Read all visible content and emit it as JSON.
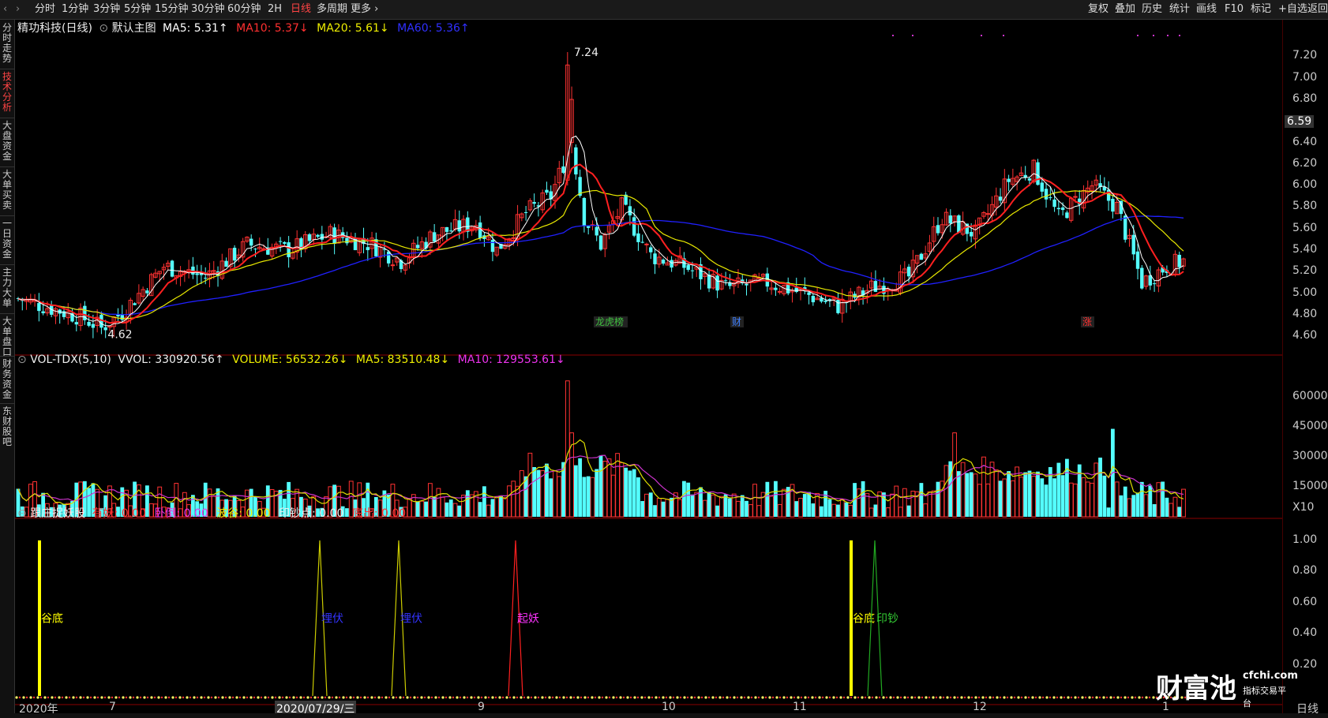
{
  "toolbar": {
    "periods": [
      {
        "label": "分时",
        "selected": false
      },
      {
        "label": "1分钟",
        "selected": false
      },
      {
        "label": "3分钟",
        "selected": false
      },
      {
        "label": "5分钟",
        "selected": false
      },
      {
        "label": "15分钟",
        "selected": false
      },
      {
        "label": "30分钟",
        "selected": false
      },
      {
        "label": "60分钟",
        "selected": false
      },
      {
        "label": "2H",
        "selected": false
      },
      {
        "label": "日线",
        "selected": true
      },
      {
        "label": "多周期",
        "selected": false
      }
    ],
    "more_label": "更多",
    "tools": [
      "复权",
      "叠加",
      "历史",
      "统计",
      "画线",
      "F10",
      "标记",
      "+自选",
      "返回"
    ]
  },
  "left_tabs": [
    {
      "label": "分时走势",
      "selected": false
    },
    {
      "label": "技术分析",
      "selected": true
    },
    {
      "label": "大盘资金",
      "selected": false
    },
    {
      "label": "大单买卖",
      "selected": false
    },
    {
      "label": "一日资金",
      "selected": false
    },
    {
      "label": "主力大单",
      "selected": false
    },
    {
      "label": "大单盘口",
      "selected": false
    },
    {
      "label": "财务资金",
      "selected": false
    },
    {
      "label": "东财股吧",
      "selected": false
    }
  ],
  "main_legend": {
    "stock": "精功科技(日线)",
    "template": "默认主图",
    "ma5": "MA5: 5.31↑",
    "ma10": "MA10: 5.37↓",
    "ma20": "MA20: 5.61↓",
    "ma60": "MA60: 5.36↑"
  },
  "main_axis": {
    "ticks": [
      "7.20",
      "7.00",
      "6.80",
      "6.40",
      "6.20",
      "6.00",
      "5.80",
      "5.60",
      "5.40",
      "5.20",
      "5.00",
      "4.80",
      "4.60"
    ],
    "current_price": "6.59",
    "high_label": "7.24",
    "low_label": "4.62"
  },
  "event_markers": [
    "龙虎榜",
    "财",
    "涨"
  ],
  "volume_legend": {
    "name": "VOL-TDX(5,10)",
    "vvol": "VVOL: 330920.56↑",
    "volume": "VOLUME: 56532.26↓",
    "ma5": "MA5: 83510.48↓",
    "ma10": "MA10: 129553.61↓"
  },
  "volume_axis": {
    "ticks": [
      "60000",
      "45000",
      "30000",
      "15000"
    ],
    "unit": "X10"
  },
  "indicator_legend": {
    "name": "跟庄捉妖股",
    "youyao": "有妖: 0.00",
    "wodao": "卧倒: 0.00",
    "bogu": "波谷: 0.00",
    "yinchao": "印钞点: 0.00",
    "dichu": "底出: 0.00"
  },
  "indicator_axis": {
    "ticks": [
      "1.00",
      "0.80",
      "0.60",
      "0.40",
      "0.20"
    ]
  },
  "indicator_signals": [
    {
      "label": "谷底",
      "color": "#ffff00"
    },
    {
      "label": "埋伏",
      "color": "#3333ff"
    },
    {
      "label": "埋伏",
      "color": "#3333ff"
    },
    {
      "label": "起妖",
      "color": "#ff33ff"
    },
    {
      "label": "谷底",
      "color": "#ffff00"
    },
    {
      "label": "印钞",
      "color": "#33cc33"
    }
  ],
  "x_axis": {
    "labels": [
      "2020年",
      "7",
      "2020/07/29/三",
      "9",
      "10",
      "11",
      "12",
      "1"
    ],
    "period": "日线"
  },
  "watermark": {
    "brand": "财富池",
    "domain": "cfchi.com",
    "slogan": "指标交易平台"
  },
  "colors": {
    "up": "#ff3232",
    "down": "#54ffff",
    "ma5": "#ffffff",
    "ma10": "#ff2020",
    "ma20": "#e8e800",
    "ma60": "#2020ff"
  }
}
